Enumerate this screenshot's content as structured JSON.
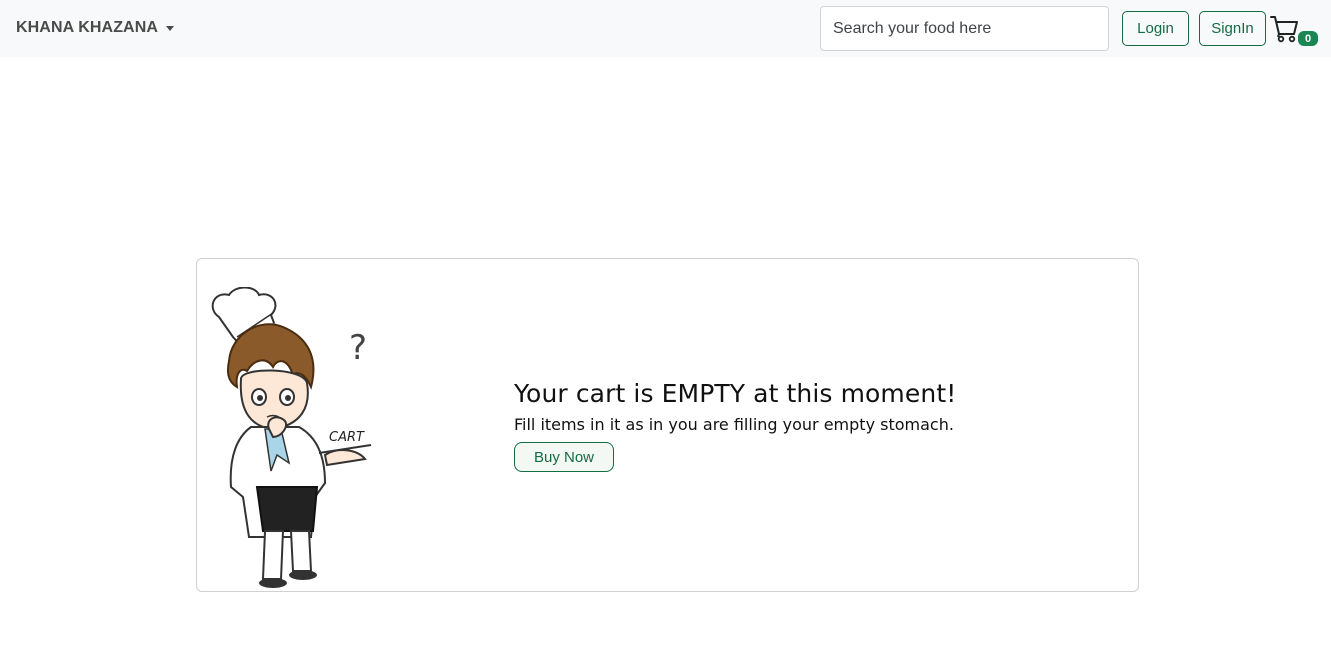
{
  "navbar": {
    "brand": "KHANA KHAZANA",
    "search_placeholder": "Search your food here",
    "login_label": "Login",
    "signin_label": "SignIn",
    "cart_count": "0"
  },
  "empty_cart": {
    "illustration_label": "CART",
    "heading": "Your cart is EMPTY at this moment!",
    "message": "Fill items in it as in you are filling your empty stomach.",
    "buy_now_label": "Buy Now"
  },
  "colors": {
    "accent": "#146c43",
    "badge": "#198754",
    "navbar_bg": "#f8f9fa"
  }
}
